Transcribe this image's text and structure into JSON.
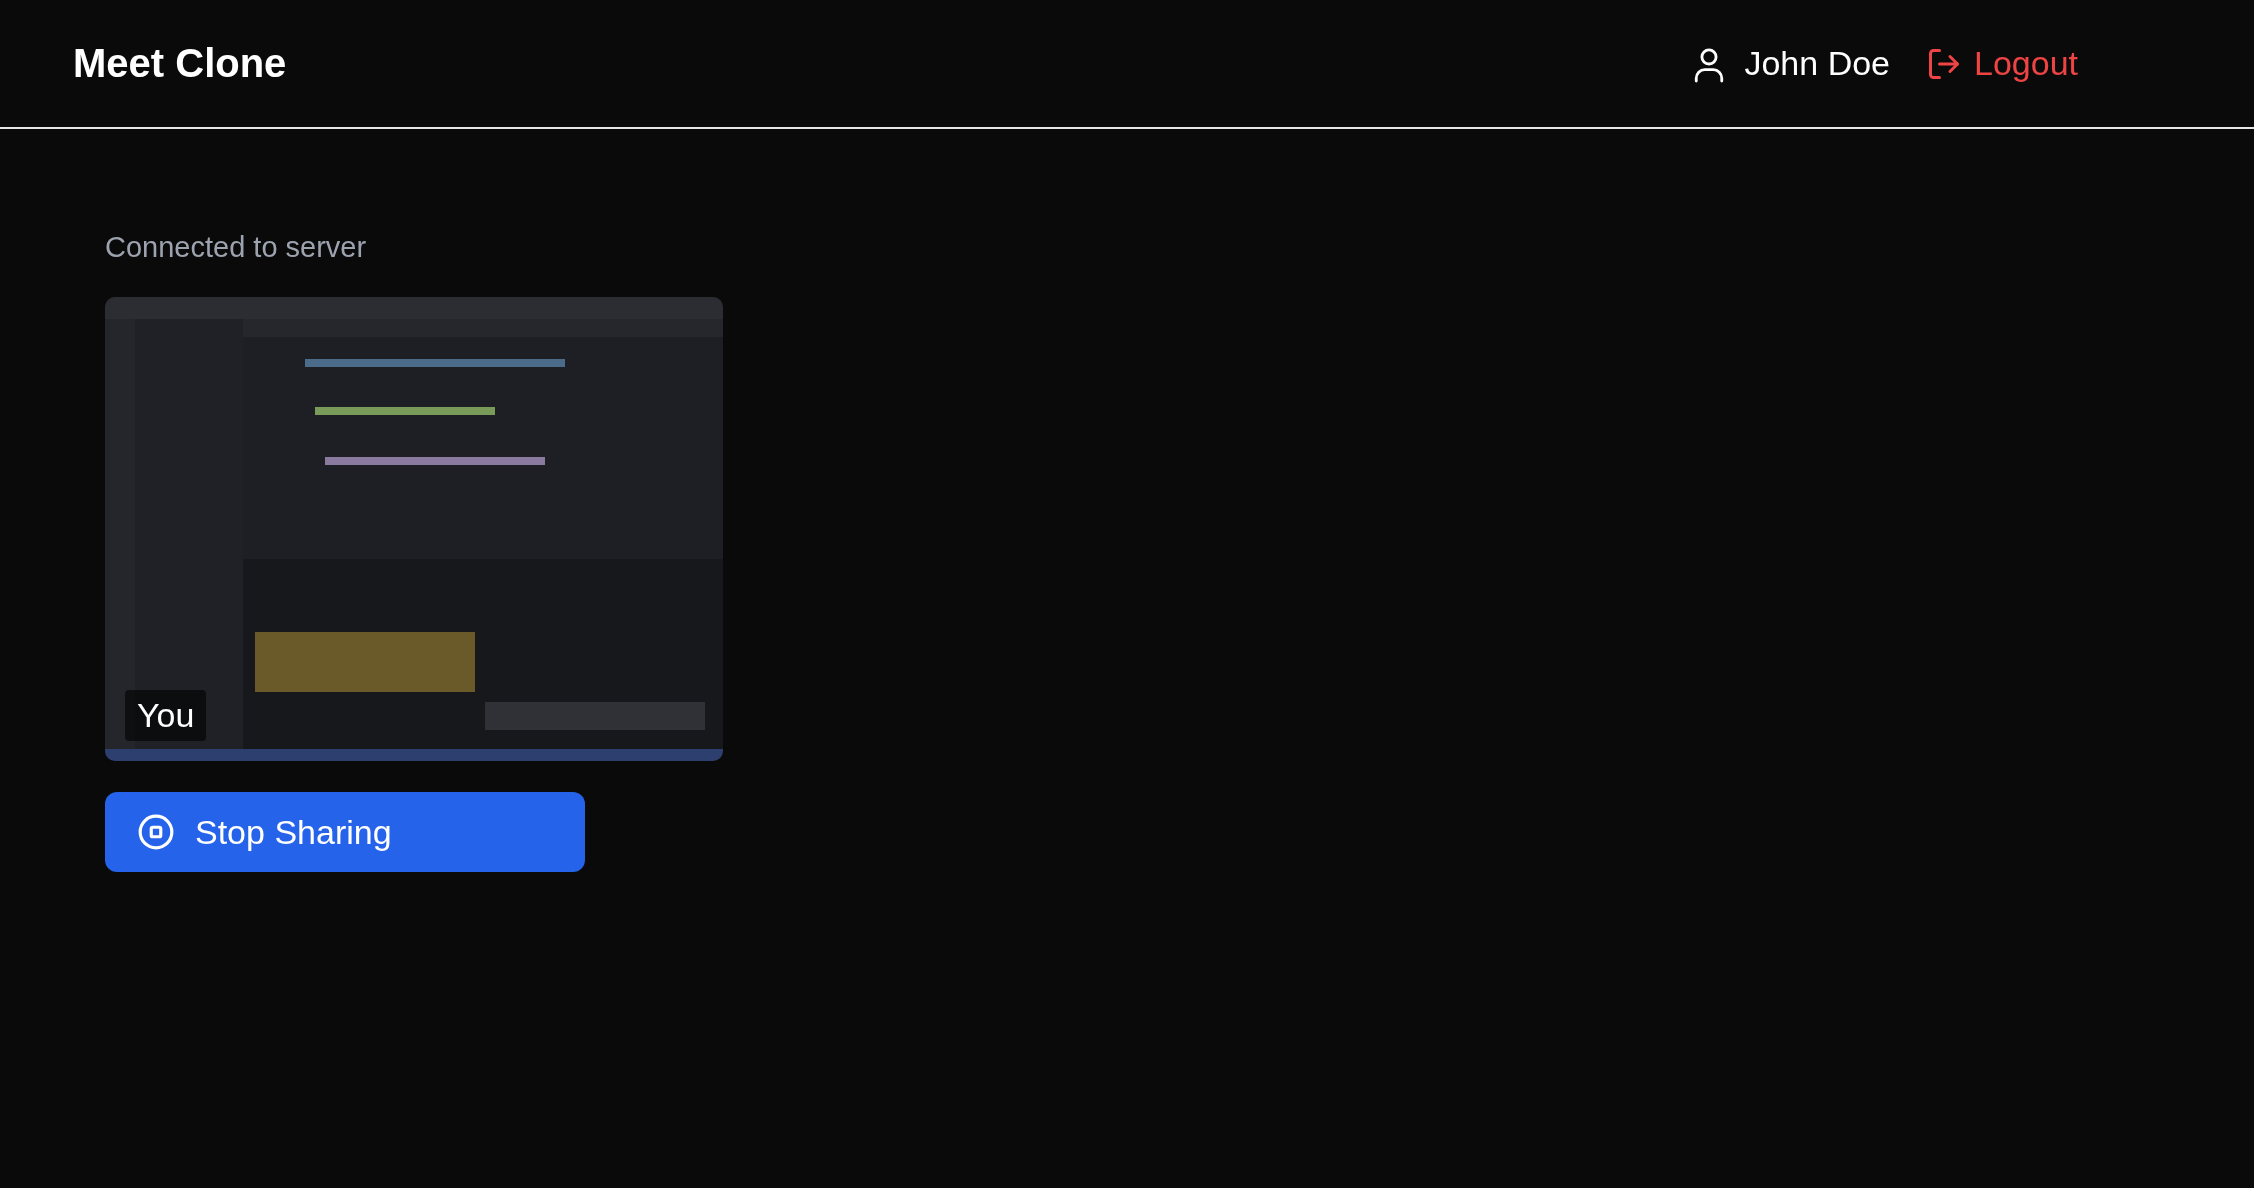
{
  "header": {
    "title": "Meet Clone",
    "user": "John Doe",
    "logout": "Logout"
  },
  "status": "Connected to server",
  "video": {
    "kind": "picture",
    "label": "You"
  },
  "share_button": {
    "label": "Stop Sharing"
  }
}
